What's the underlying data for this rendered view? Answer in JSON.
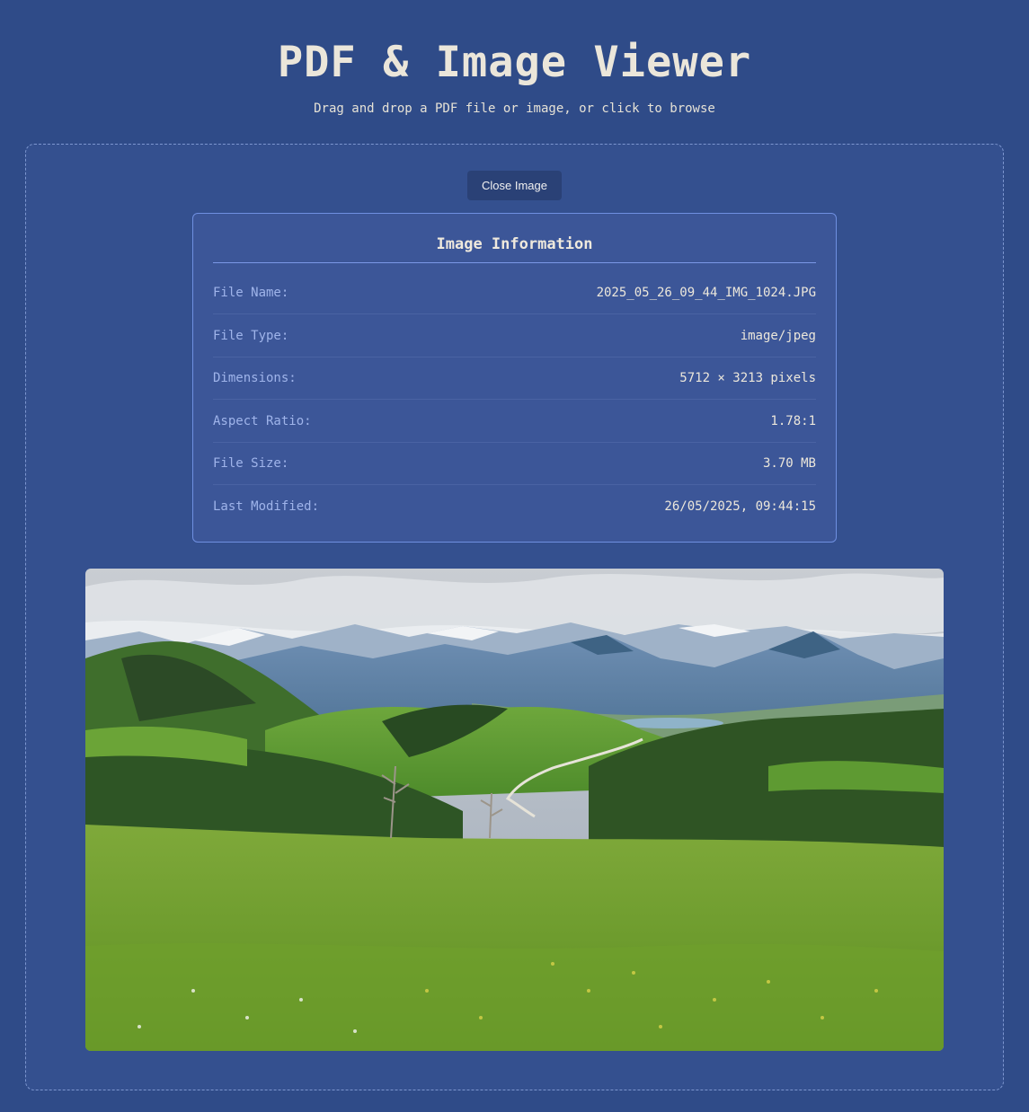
{
  "header": {
    "title": "PDF & Image Viewer",
    "subtitle": "Drag and drop a PDF file or image, or click to browse"
  },
  "toolbar": {
    "close_label": "Close Image"
  },
  "info": {
    "title": "Image Information",
    "rows": [
      {
        "label": "File Name:",
        "value": "2025_05_26_09_44_IMG_1024.JPG"
      },
      {
        "label": "File Type:",
        "value": "image/jpeg"
      },
      {
        "label": "Dimensions:",
        "value": "5712 × 3213 pixels"
      },
      {
        "label": "Aspect Ratio:",
        "value": "1.78:1"
      },
      {
        "label": "File Size:",
        "value": "3.70 MB"
      },
      {
        "label": "Last Modified:",
        "value": "26/05/2025, 09:44:15"
      }
    ]
  },
  "colors": {
    "background": "#2f4b88",
    "panel": "#3c5698",
    "panel_border": "#6f8fe0",
    "button": "#2a4176",
    "label": "#9fb4ea"
  },
  "image": {
    "subject": "alpine-meadow-landscape"
  }
}
